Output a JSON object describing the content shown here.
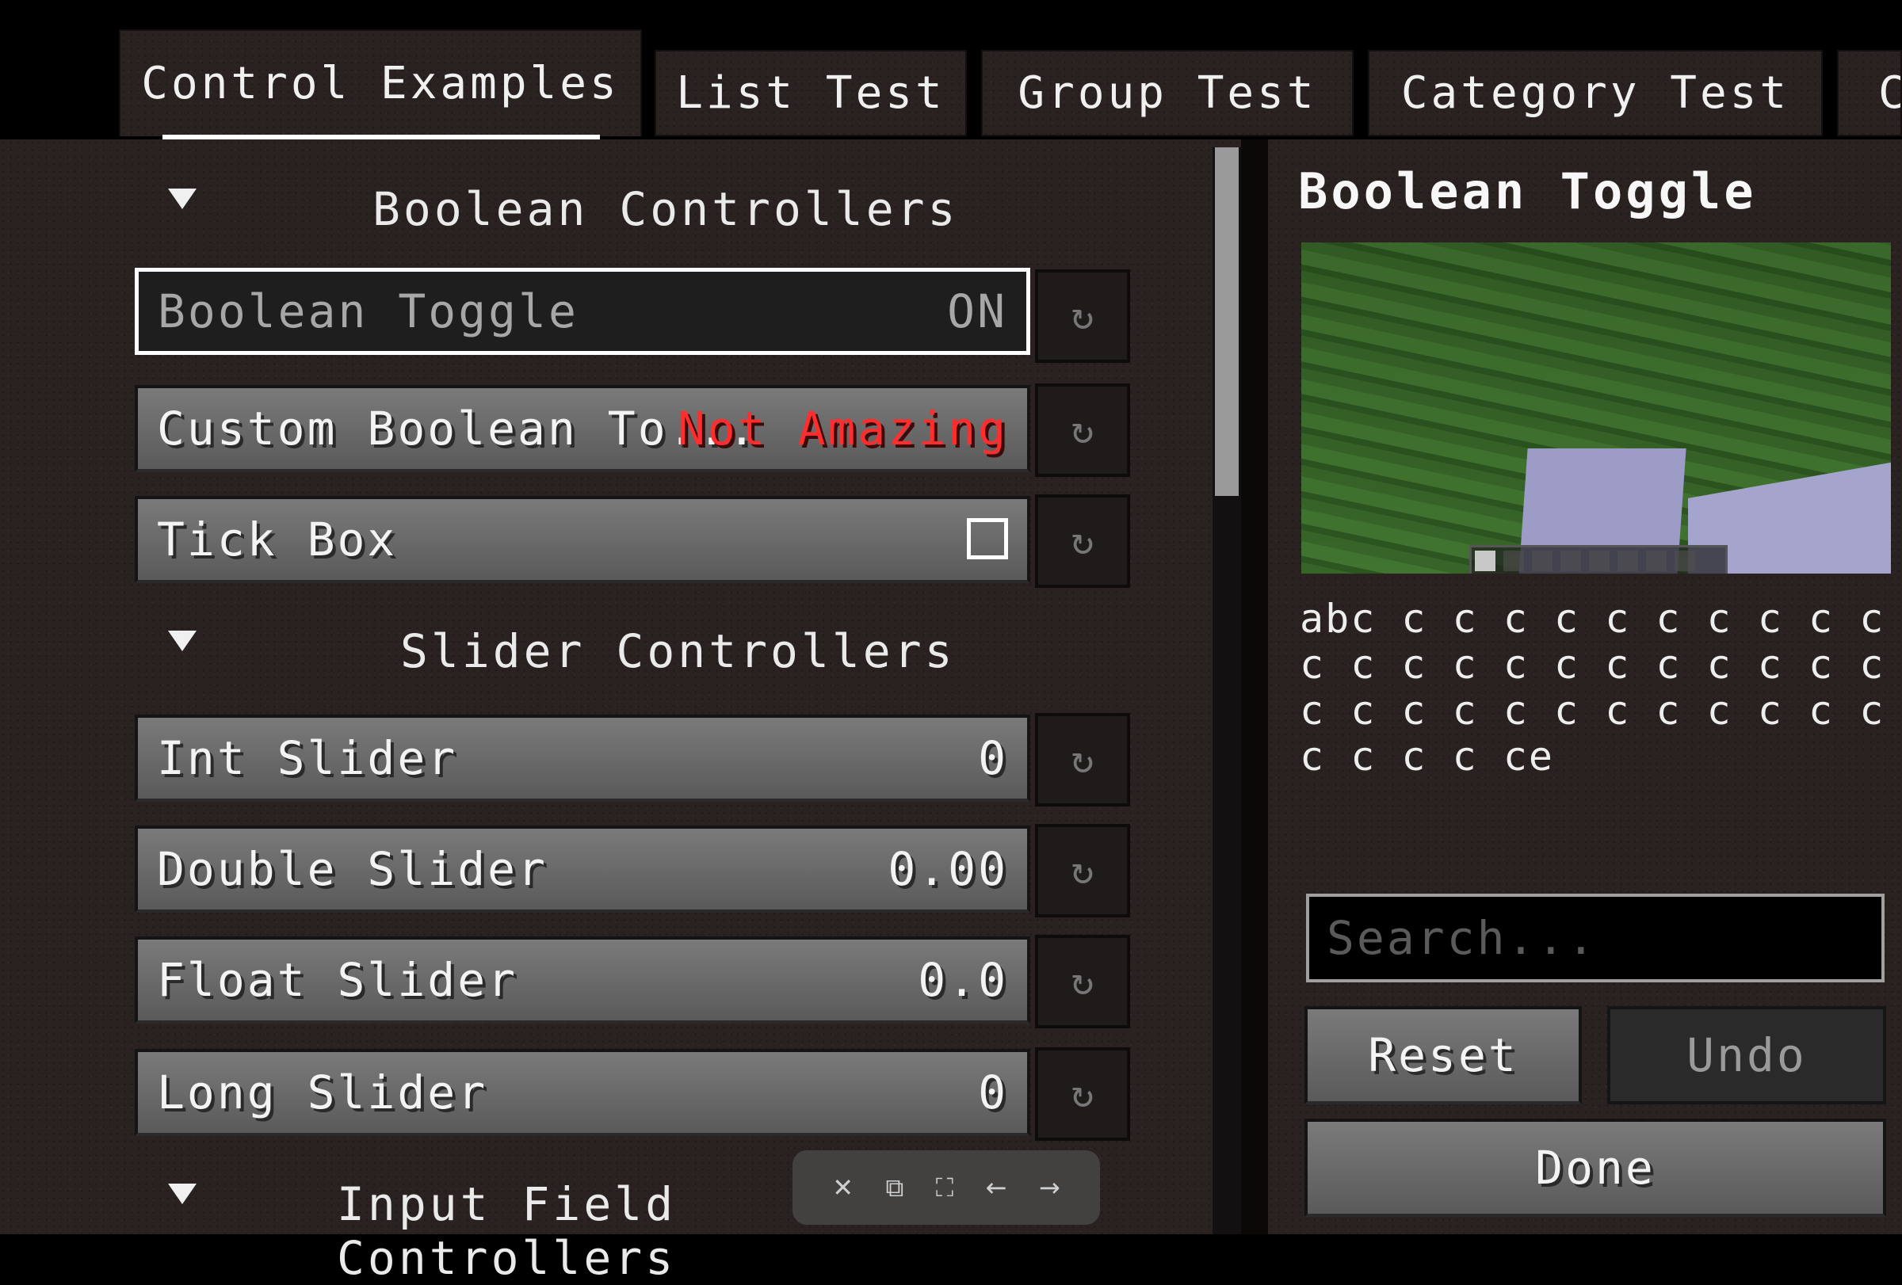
{
  "tabs": [
    {
      "label": "Control Examples"
    },
    {
      "label": "List Test"
    },
    {
      "label": "Group Test"
    },
    {
      "label": "Category Test"
    },
    {
      "label": "C"
    }
  ],
  "categories": {
    "boolean": "Boolean Controllers",
    "slider": "Slider Controllers",
    "input": "Input Field Controllers"
  },
  "options": {
    "boolean_toggle": {
      "label": "Boolean Toggle",
      "value": "ON"
    },
    "custom_boolean": {
      "label": "Custom Boolean To...",
      "value": "Not Amazing"
    },
    "tick_box": {
      "label": "Tick Box"
    },
    "int_slider": {
      "label": "Int Slider",
      "value": "0"
    },
    "double_slider": {
      "label": "Double Slider",
      "value": "0.00"
    },
    "float_slider": {
      "label": "Float Slider",
      "value": "0.0"
    },
    "long_slider": {
      "label": "Long Slider",
      "value": "0"
    }
  },
  "detail": {
    "title": "Boolean Toggle",
    "description": "abc c c c c c c c c c c c c c c c c c c c c c c c c c c c c c c c c c c c c c c ce"
  },
  "search": {
    "placeholder": "Search..."
  },
  "buttons": {
    "reset": "Reset",
    "undo": "Undo",
    "done": "Done"
  },
  "colors": {
    "accent_red": "#ff2d2d",
    "selected_border": "#ffffff"
  }
}
